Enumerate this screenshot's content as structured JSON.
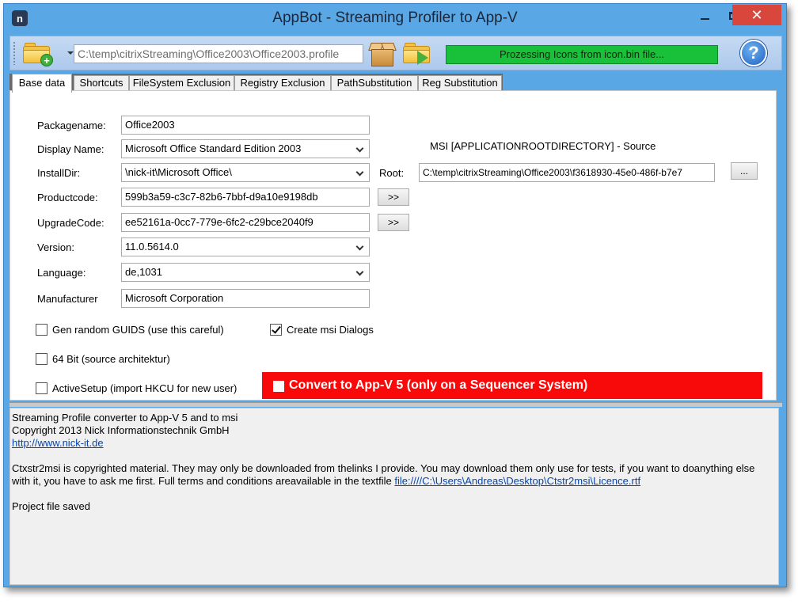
{
  "window": {
    "title": "AppBot - Streaming Profiler to App-V",
    "app_icon_glyph": "n"
  },
  "toolbar": {
    "profile_path": "C:\\temp\\citrixStreaming\\Office2003\\Office2003.profile",
    "status_text": "Prozessing Icons from icon.bin file...",
    "status_color": "#19c03a",
    "help_glyph": "?"
  },
  "tabs": [
    {
      "label": "Base data",
      "active": true
    },
    {
      "label": "Shortcuts"
    },
    {
      "label": "FileSystem Exclusion"
    },
    {
      "label": "Registry Exclusion"
    },
    {
      "label": "PathSubstitution"
    },
    {
      "label": "Reg Substitution"
    }
  ],
  "form": {
    "packagename": {
      "label": "Packagename:",
      "value": "Office2003"
    },
    "display_name": {
      "label": "Display Name:",
      "value": "Microsoft Office Standard Edition 2003"
    },
    "install_dir": {
      "label": "InstallDir:",
      "value": "\\nick-it\\Microsoft Office\\"
    },
    "productcode": {
      "label": "Productcode:",
      "value": "599b3a59-c3c7-82b6-7bbf-d9a10e9198db",
      "button": ">>"
    },
    "upgradecode": {
      "label": "UpgradeCode:",
      "value": "ee52161a-0cc7-779e-6fc2-c29bce2040f9",
      "button": ">>"
    },
    "version": {
      "label": "Version:",
      "value": "11.0.5614.0"
    },
    "language": {
      "label": "Language:",
      "value": "de,1031"
    },
    "manufacturer": {
      "label": "Manufacturer",
      "value": "Microsoft Corporation"
    },
    "msi_source_title": "MSI [APPLICATIONROOTDIRECTORY] - Source",
    "root": {
      "label": "Root:",
      "value": "C:\\temp\\citrixStreaming\\Office2003\\f3618930-45e0-486f-b7e7",
      "button": "..."
    },
    "gen_random_guids": {
      "label": "Gen random GUIDS (use this careful)",
      "checked": false
    },
    "create_msi_dialogs": {
      "label": "Create msi Dialogs",
      "checked": true
    },
    "bit64": {
      "label": "64 Bit (source architektur)",
      "checked": false
    },
    "active_setup": {
      "label": "ActiveSetup (import HKCU for new user)",
      "checked": false
    },
    "convert_button": {
      "label": "Convert to App-V 5 (only on a Sequencer System)",
      "color": "#f90a0a"
    }
  },
  "log": {
    "line1": "Streaming Profile converter to App-V 5 and to msi",
    "line2": "Copyright 2013 Nick Informationstechnik GmbH",
    "link1": "http://www.nick-it.de",
    "line4": "Ctxstr2msi is copyrighted material. They may only be downloaded from thelinks I provide.  You may download them only use for tests, if you want to doanything else",
    "line5_prefix": "with it, you have to ask me first.  Full terms and conditions areavailable in the textfile ",
    "link2": "file:////C:\\Users\\Andreas\\Desktop\\Ctstr2msi\\Licence.rtf",
    "line7": "Project file saved"
  }
}
